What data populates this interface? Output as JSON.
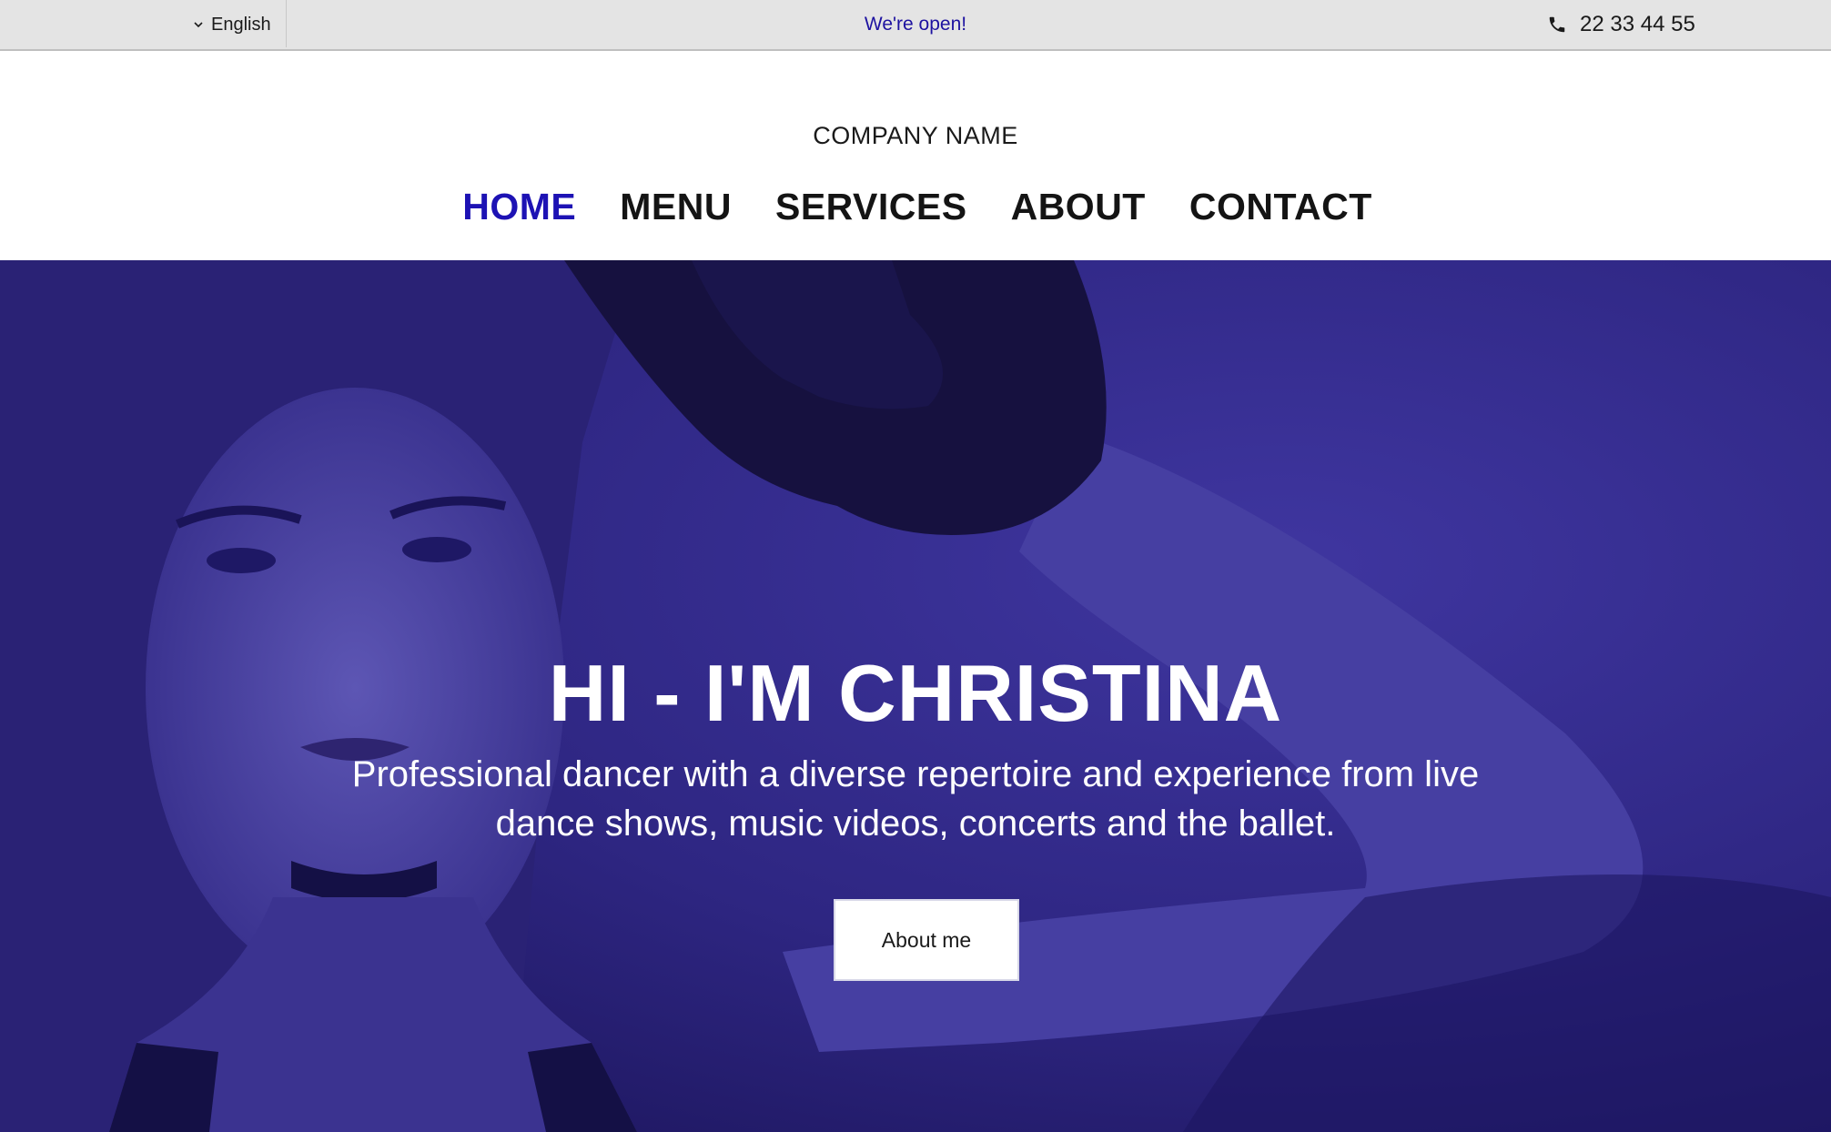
{
  "topbar": {
    "language": "English",
    "open_text": "We're open!",
    "phone": "22 33 44 55"
  },
  "header": {
    "company_name": "COMPANY NAME",
    "nav": [
      {
        "label": "HOME",
        "active": true
      },
      {
        "label": "MENU",
        "active": false
      },
      {
        "label": "SERVICES",
        "active": false
      },
      {
        "label": "ABOUT",
        "active": false
      },
      {
        "label": "CONTACT",
        "active": false
      }
    ]
  },
  "hero": {
    "title": "HI - I'M CHRISTINA",
    "subtitle": "Professional dancer with a diverse repertoire and experience from live dance shows, music videos, concerts and the ballet.",
    "button_label": "About me"
  },
  "colors": {
    "accent": "#1d12b4",
    "hero_overlay": "#2d2478",
    "topbar_bg": "#e4e4e4"
  },
  "icons": {
    "language_toggle": "chevron-down-icon",
    "phone": "phone-icon"
  }
}
